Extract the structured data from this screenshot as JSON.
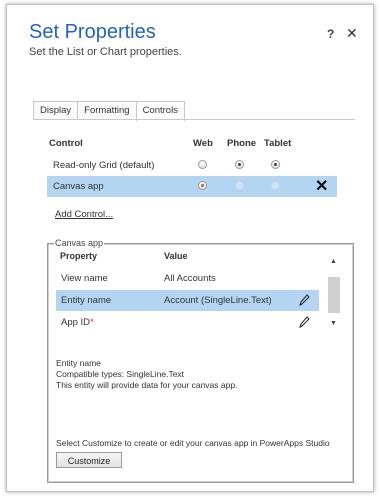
{
  "dialog": {
    "title": "Set Properties",
    "subtitle": "Set the List or Chart properties.",
    "help_label": "?",
    "close_label": "✕"
  },
  "tabs": [
    {
      "label": "Display",
      "active": false
    },
    {
      "label": "Formatting",
      "active": false
    },
    {
      "label": "Controls",
      "active": true
    }
  ],
  "controls": {
    "headers": {
      "control": "Control",
      "web": "Web",
      "phone": "Phone",
      "tablet": "Tablet"
    },
    "rows": [
      {
        "label": "Read-only Grid (default)",
        "web": false,
        "phone": true,
        "tablet": true,
        "selected": false
      },
      {
        "label": "Canvas app",
        "web": true,
        "phone": false,
        "tablet": false,
        "selected": true,
        "remove_label": "✕"
      }
    ],
    "add_link": "Add Control..."
  },
  "canvas_app": {
    "legend": "Canvas app",
    "headers": {
      "property": "Property",
      "value": "Value"
    },
    "properties": [
      {
        "name": "View name",
        "value": "All Accounts",
        "required": false,
        "editable": false,
        "selected": false
      },
      {
        "name": "Entity name",
        "value": "Account (SingleLine.Text)",
        "required": false,
        "editable": true,
        "selected": true
      },
      {
        "name": "App ID",
        "value": "",
        "required": true,
        "editable": true,
        "selected": false
      }
    ],
    "required_mark": "*",
    "description": {
      "line1": "Entity name",
      "line2": "Compatible types: SingleLine.Text",
      "line3": "This entity will provide data for your canvas app."
    },
    "hint": "Select Customize to create or edit your canvas app in PowerApps Studio",
    "customize_label": "Customize"
  },
  "colors": {
    "title": "#2266b8",
    "selection": "#b3d5f2",
    "required": "#d03030"
  }
}
